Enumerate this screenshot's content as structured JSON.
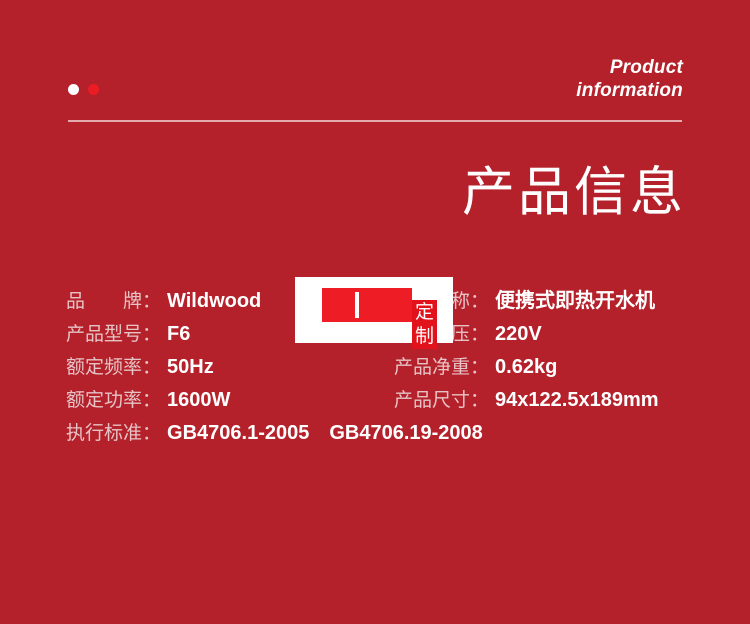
{
  "background_color": "#b5212b",
  "header": {
    "dots": [
      {
        "name": "dot-white",
        "color": "#ffffff"
      },
      {
        "name": "dot-red",
        "color": "#ec1c24"
      }
    ],
    "kicker_line1": "Product",
    "kicker_line2": "information",
    "title": "产品信息"
  },
  "specs": {
    "rows": [
      {
        "left": {
          "label": "品　　牌",
          "colon": "：",
          "value": "Wildwood",
          "latin": true
        },
        "right": {
          "label": "产品名称",
          "colon": "：",
          "value": "便携式即热开水机",
          "latin": false
        }
      },
      {
        "left": {
          "label": "产品型号",
          "colon": "：",
          "value": "F6",
          "latin": true
        },
        "right": {
          "label": "额定电压",
          "colon": "：",
          "value": "220V",
          "latin": true
        }
      },
      {
        "left": {
          "label": "额定频率",
          "colon": "：",
          "value": "50Hz",
          "latin": true
        },
        "right": {
          "label": "产品净重",
          "colon": "：",
          "value": "0.62kg",
          "latin": true
        }
      },
      {
        "left": {
          "label": "额定功率",
          "colon": "：",
          "value": "1600W",
          "latin": true
        },
        "right": {
          "label": "产品尺寸",
          "colon": "：",
          "value": "94x122.5x189mm",
          "latin": true
        }
      }
    ],
    "full_row": {
      "label": "执行标准",
      "colon": "：",
      "value": "GB4706.1-2005　GB4706.19-2008"
    }
  },
  "watermark": {
    "frame_color": "#ee1c25",
    "badge_color": "#e1121b",
    "badge_char_1": "定",
    "badge_char_2": "制"
  }
}
